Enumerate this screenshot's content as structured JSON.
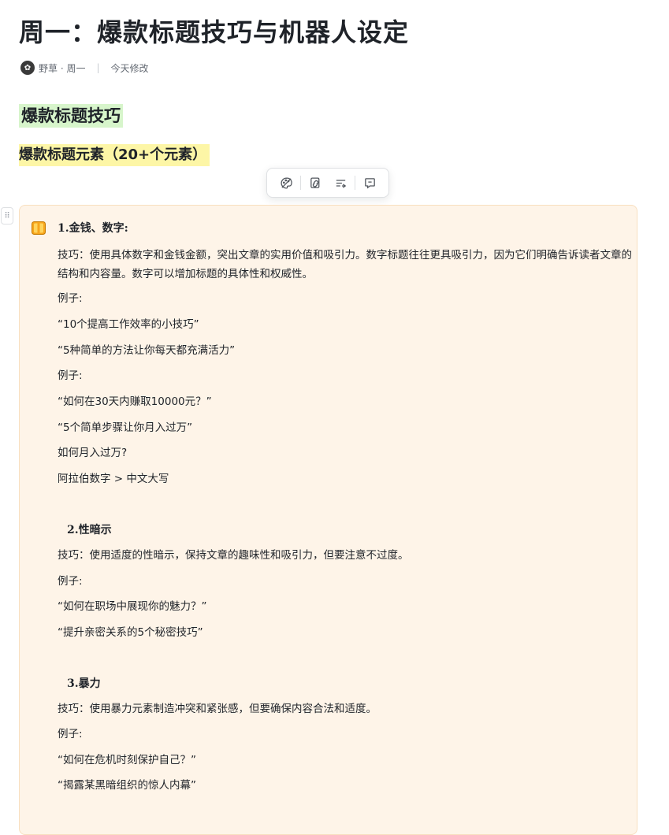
{
  "doc": {
    "title": "周一：爆款标题技巧与机器人设定",
    "author": "野草 · 周一",
    "modified": "今天修改"
  },
  "headings": {
    "h1": "爆款标题技巧",
    "h2": "爆款标题元素（20+个元素）"
  },
  "callout": {
    "emoji": "book-icon",
    "sections": [
      {
        "title": "1.金钱、数字:",
        "tip": "技巧：使用具体数字和金钱金额，突出文章的实用价值和吸引力。数字标题往往更具吸引力，因为它们明确告诉读者文章的结构和内容量。数字可以增加标题的具体性和权威性。",
        "lines": [
          "例子:",
          "“10个提高工作效率的小技巧”",
          "“5种简单的方法让你每天都充满活力”",
          "例子:",
          "“如何在30天内赚取10000元？”",
          "“5个简单步骤让你月入过万”",
          "如何月入过万?",
          "阿拉伯数字 > 中文大写"
        ]
      },
      {
        "title": "2.性暗示",
        "tip": "技巧：使用适度的性暗示，保持文章的趣味性和吸引力，但要注意不过度。",
        "lines": [
          "例子:",
          "“如何在职场中展现你的魅力？”",
          "“提升亲密关系的5个秘密技巧”"
        ]
      },
      {
        "title": "3.暴力",
        "tip": "技巧：使用暴力元素制造冲突和紧张感，但要确保内容合法和适度。",
        "lines": [
          "例子:",
          "“如何在危机时刻保护自己？”",
          "“揭露某黑暗组织的惊人内幕”"
        ]
      }
    ]
  },
  "colors": {
    "h1_highlight": "#d7f5cb",
    "h2_highlight": "#fdf6a6",
    "callout_bg": "#fef4e8",
    "callout_border": "#f8dfbf"
  },
  "toolbar": {
    "icons": [
      "palette-icon",
      "link-icon",
      "text-wrap-icon",
      "comment-icon"
    ]
  }
}
